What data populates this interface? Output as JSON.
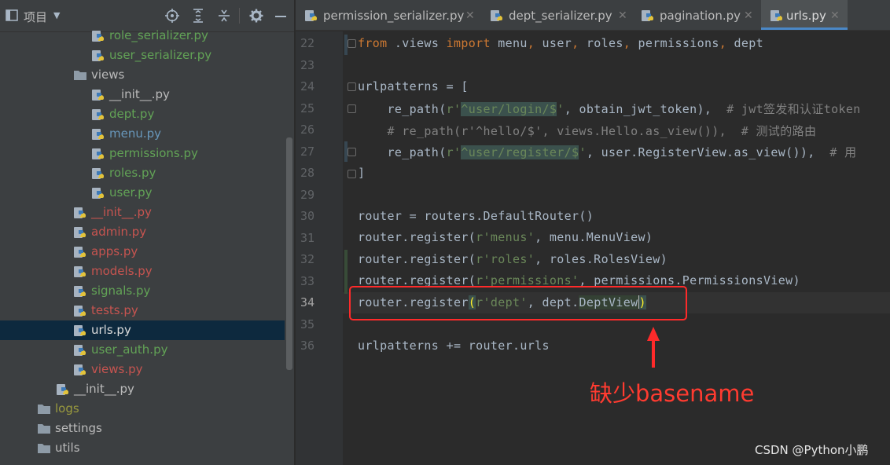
{
  "project_panel": {
    "title": "项目",
    "toolbar_icons": [
      "locate-icon",
      "expand-all-icon",
      "collapse-all-icon",
      "gear-icon",
      "minimize-icon"
    ],
    "tree": [
      {
        "label": "role_serializer.py",
        "kind": "py",
        "color": "green"
      },
      {
        "label": "user_serializer.py",
        "kind": "py",
        "color": "green"
      },
      {
        "label": "views",
        "kind": "folder",
        "color": "white",
        "expanded": true
      },
      {
        "label": "__init__.py",
        "kind": "py",
        "color": "white"
      },
      {
        "label": "dept.py",
        "kind": "py",
        "color": "green"
      },
      {
        "label": "menu.py",
        "kind": "py",
        "color": "blue"
      },
      {
        "label": "permissions.py",
        "kind": "py",
        "color": "green"
      },
      {
        "label": "roles.py",
        "kind": "py",
        "color": "green"
      },
      {
        "label": "user.py",
        "kind": "py",
        "color": "green"
      },
      {
        "label": "__init__.py",
        "kind": "py",
        "color": "red"
      },
      {
        "label": "admin.py",
        "kind": "py",
        "color": "red"
      },
      {
        "label": "apps.py",
        "kind": "py",
        "color": "red"
      },
      {
        "label": "models.py",
        "kind": "py",
        "color": "red"
      },
      {
        "label": "signals.py",
        "kind": "py",
        "color": "green"
      },
      {
        "label": "tests.py",
        "kind": "py",
        "color": "red"
      },
      {
        "label": "urls.py",
        "kind": "py",
        "color": "selected",
        "selected": true
      },
      {
        "label": "user_auth.py",
        "kind": "py",
        "color": "green"
      },
      {
        "label": "views.py",
        "kind": "py",
        "color": "red"
      },
      {
        "label": "__init__.py",
        "kind": "py",
        "color": "white"
      },
      {
        "label": "logs",
        "kind": "folder",
        "color": "olive",
        "expanded": false
      },
      {
        "label": "settings",
        "kind": "folder",
        "color": "white",
        "expanded": false
      },
      {
        "label": "utils",
        "kind": "folder",
        "color": "white",
        "expanded": true
      }
    ]
  },
  "tabs": [
    {
      "label": "permission_serializer.py",
      "active": false
    },
    {
      "label": "dept_serializer.py",
      "active": false
    },
    {
      "label": "pagination.py",
      "active": false
    },
    {
      "label": "urls.py",
      "active": true
    }
  ],
  "editor": {
    "current_line": 34,
    "lines": [
      {
        "no": 22
      },
      {
        "no": 23
      },
      {
        "no": 24
      },
      {
        "no": 25
      },
      {
        "no": 26
      },
      {
        "no": 27
      },
      {
        "no": 28
      },
      {
        "no": 29
      },
      {
        "no": 30
      },
      {
        "no": 31
      },
      {
        "no": 32
      },
      {
        "no": 33
      },
      {
        "no": 34
      },
      {
        "no": 35
      },
      {
        "no": 36
      }
    ],
    "code": {
      "l22": {
        "kw1": "from",
        "t1": " .views ",
        "kw2": "import",
        "t2": " menu",
        "c1": ",",
        "t3": " user",
        "c2": ",",
        "t4": " roles",
        "c3": ",",
        "t5": " permissions",
        "c4": ",",
        "t6": " dept"
      },
      "l24": {
        "t1": "urlpatterns = ["
      },
      "l25": {
        "t1": "    re_path(",
        "s1": "r'",
        "rx": "^user/login/$",
        "s2": "'",
        "t2": ", obtain_jwt_token),  ",
        "cmt": "# jwt签发和认证token"
      },
      "l26": {
        "cmt": "    # re_path(r'^hello/$', views.Hello.as_view()),  # 测试的路由"
      },
      "l27": {
        "t1": "    re_path(",
        "s1": "r'",
        "rx": "^user/register/$",
        "s2": "'",
        "t2": ", user.RegisterView.as_view()),  ",
        "cmt": "# 用"
      },
      "l28": {
        "t1": "]"
      },
      "l30": {
        "t1": "router = routers.DefaultRouter()"
      },
      "l31": {
        "t1": "router.register(",
        "s1": "r'menus'",
        "t2": ", menu.MenuView)"
      },
      "l32": {
        "t1": "router.register(",
        "s1": "r'roles'",
        "t2": ", roles.RolesView)"
      },
      "l33": {
        "t1": "router.register(",
        "s1": "r'permissions'",
        "t2": ", permissions.PermissionsView)"
      },
      "l34": {
        "t1": "router.register",
        "p1": "(",
        "s1": "r'dept'",
        "t2": ", dept.",
        "t3": "DeptView",
        "p2": ")"
      },
      "l36": {
        "t1": "urlpatterns += router.urls"
      }
    }
  },
  "annotation": {
    "text": "缺少basename",
    "color": "#ff3b30"
  },
  "watermark": "CSDN @Python小鹏",
  "colors": {
    "keyword": "#cc7832",
    "string": "#6a8759",
    "comment": "#808080",
    "selection": "#0d293e",
    "tab_underline": "#4a88c7"
  }
}
